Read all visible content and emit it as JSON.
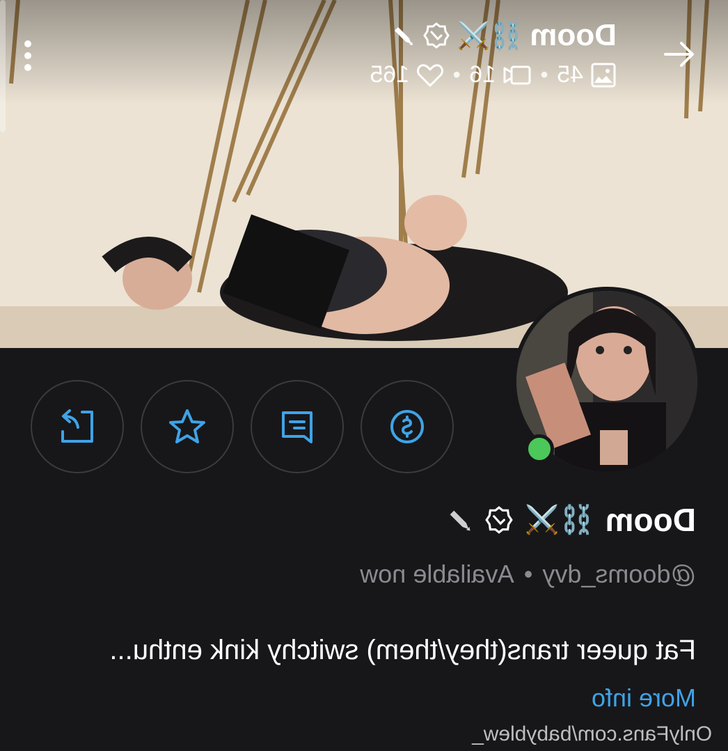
{
  "header": {
    "name": "Doom",
    "emojis": "⛓️⚔️",
    "stats": {
      "images": "45",
      "videos": "16",
      "likes": "165"
    }
  },
  "profile": {
    "name": "Doom",
    "emojis": "⛓️⚔️",
    "handle": "@dooms_dvy",
    "status": "Available now",
    "bio": "Fat queer trans(they/them) switchy kink enthu...",
    "more_info": "More info"
  },
  "watermark": "OnlyFans.com/babyblew_",
  "colors": {
    "accent": "#3fa3e6",
    "online": "#4cc75a",
    "background": "#17171a"
  },
  "icons": {
    "back": "arrow-left-icon",
    "more": "vertical-dots-icon",
    "verified": "verified-badge-icon",
    "edit": "pencil-icon",
    "images": "image-icon",
    "videos": "video-icon",
    "likes": "heart-icon",
    "tip": "dollar-circle-icon",
    "message": "message-icon",
    "favorite": "star-icon",
    "share": "share-icon"
  }
}
